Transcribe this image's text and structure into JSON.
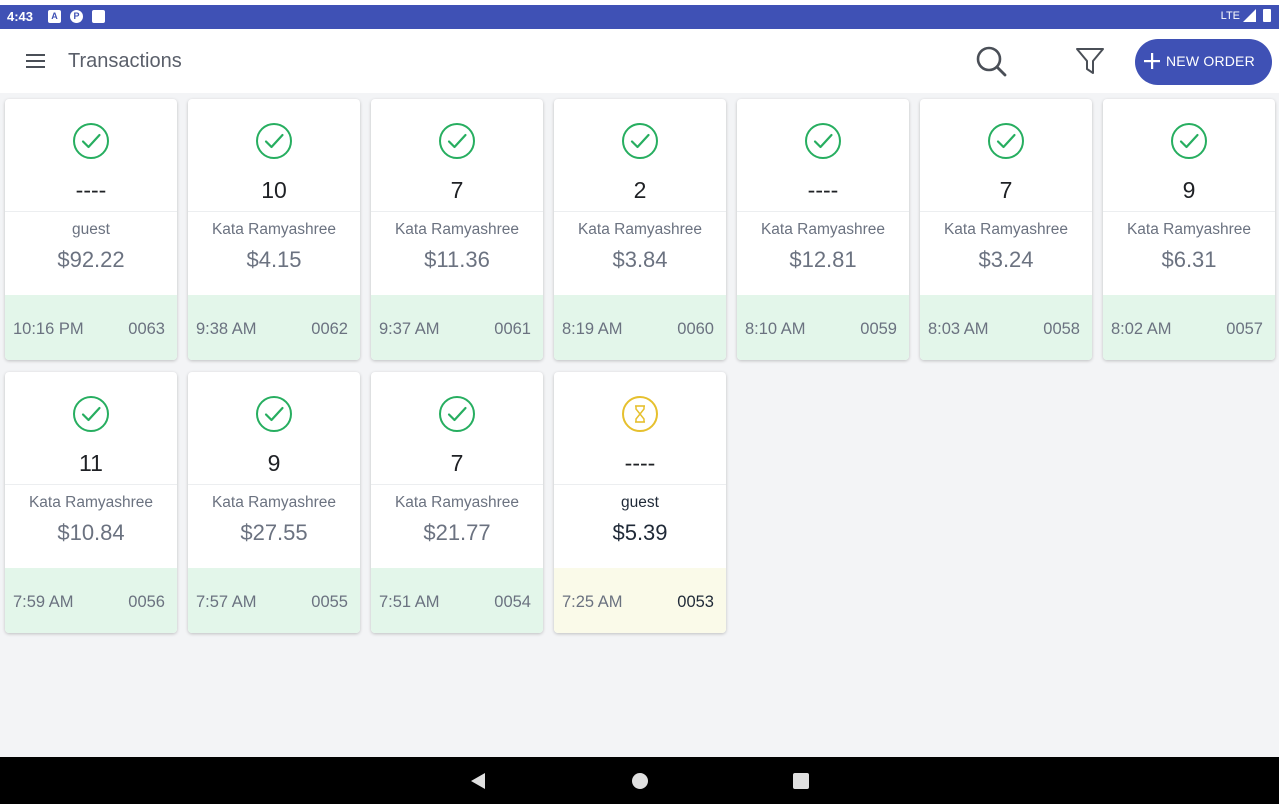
{
  "status_bar": {
    "time": "4:43",
    "network": "LTE",
    "icons": [
      "notification-a-icon",
      "notification-p-icon",
      "sd-card-icon",
      "signal-icon",
      "battery-icon"
    ]
  },
  "app_bar": {
    "title": "Transactions",
    "new_order_label": "NEW ORDER"
  },
  "colors": {
    "primary": "#3f51b5",
    "completed_icon": "#27ae60",
    "pending_icon": "#e6c02e",
    "completed_footer": "#e3f6ea",
    "pending_footer": "#fafae9"
  },
  "orders": [
    {
      "status": "completed",
      "number": "----",
      "customer": "guest",
      "amount": "$92.22",
      "time": "10:16 PM",
      "order_no": "0063"
    },
    {
      "status": "completed",
      "number": "10",
      "customer": "Kata Ramyashree",
      "amount": "$4.15",
      "time": "9:38 AM",
      "order_no": "0062"
    },
    {
      "status": "completed",
      "number": "7",
      "customer": "Kata Ramyashree",
      "amount": "$11.36",
      "time": "9:37 AM",
      "order_no": "0061"
    },
    {
      "status": "completed",
      "number": "2",
      "customer": "Kata Ramyashree",
      "amount": "$3.84",
      "time": "8:19 AM",
      "order_no": "0060"
    },
    {
      "status": "completed",
      "number": "----",
      "customer": "Kata Ramyashree",
      "amount": "$12.81",
      "time": "8:10 AM",
      "order_no": "0059"
    },
    {
      "status": "completed",
      "number": "7",
      "customer": "Kata Ramyashree",
      "amount": "$3.24",
      "time": "8:03 AM",
      "order_no": "0058"
    },
    {
      "status": "completed",
      "number": "9",
      "customer": "Kata Ramyashree",
      "amount": "$6.31",
      "time": "8:02 AM",
      "order_no": "0057"
    },
    {
      "status": "completed",
      "number": "11",
      "customer": "Kata Ramyashree",
      "amount": "$10.84",
      "time": "7:59 AM",
      "order_no": "0056"
    },
    {
      "status": "completed",
      "number": "9",
      "customer": "Kata Ramyashree",
      "amount": "$27.55",
      "time": "7:57 AM",
      "order_no": "0055"
    },
    {
      "status": "completed",
      "number": "7",
      "customer": "Kata Ramyashree",
      "amount": "$21.77",
      "time": "7:51 AM",
      "order_no": "0054"
    },
    {
      "status": "pending",
      "number": "----",
      "customer": "guest",
      "amount": "$5.39",
      "time": "7:25 AM",
      "order_no": "0053"
    }
  ]
}
